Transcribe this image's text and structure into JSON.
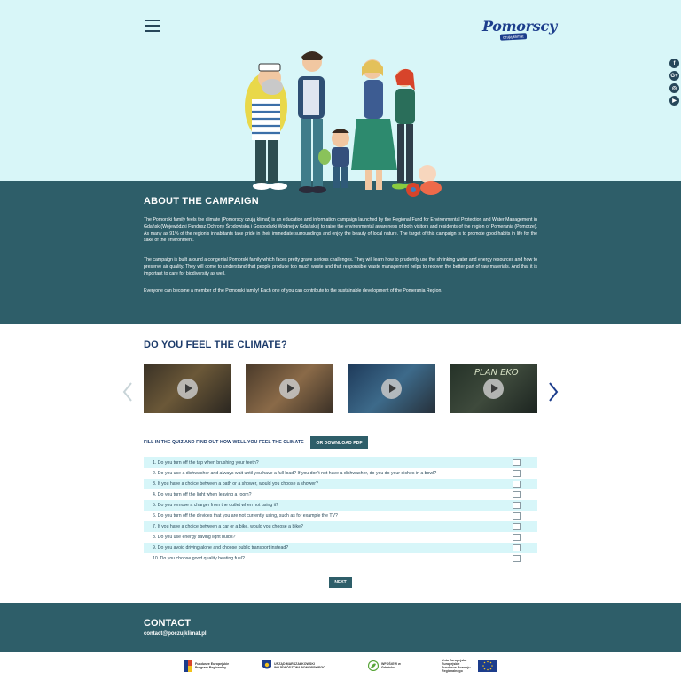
{
  "header": {
    "logo_text": "Pomorscy",
    "logo_subtext": "czują klimat"
  },
  "social": [
    {
      "label": "f",
      "icon": "facebook-icon"
    },
    {
      "label": "G+",
      "icon": "google-plus-icon"
    },
    {
      "label": "◎",
      "icon": "instagram-icon"
    },
    {
      "label": "▶",
      "icon": "youtube-icon"
    }
  ],
  "about": {
    "title": "ABOUT THE CAMPAIGN",
    "p1": "The Pomorski family feels the climate (Pomorscy czują klimat) is an education and information campaign launched by the Regional Fund for Environmental Protection and Water Management in Gdańsk (Wojewódzki Fundusz Ochrony Środowiska i Gospodarki Wodnej w Gdańsku) to raise the environmental awareness of both visitors and residents of the region of Pomerania (Pomorze). As many as 91% of the region's inhabitants take pride in their immediate surroundings and enjoy the beauty of local nature. The target of this campaign is to promote good habits in life for the sake of the environment.",
    "p2": "The campaign is built around a congenial Pomorski family which faces pretty grave serious challenges. They will learn how to prudently use the shrinking water and energy resources and how to preserve air quality. They will come to understand that people produce too much waste and that responsible waste management helps to recover the better part of raw materials. And that it is important to care for biodiversity as well.",
    "p3": "Everyone can become a member of the Pomorski family! Each one of you can contribute to the sustainable development of the Pomerania Region."
  },
  "climate": {
    "title": "DO YOU FEEL THE CLIMATE?",
    "thumb4_text": "PLAN EKO"
  },
  "quiz": {
    "intro": "FILL IN THE QUIZ AND FIND OUT HOW WELL YOU FEEL THE CLIMATE",
    "pdf_label": "OR DOWNLOAD PDF",
    "questions": [
      "1. Do you turn off the tap when brushing your teeth?",
      "2. Do you use a dishwasher and always wait until you have a full load? If you don't not have a dishwasher, do you do your dishes in a bowl?",
      "3. If you have a choice between a bath or a shower, would you choose a shower?",
      "4. Do you turn off the light when leaving a room?",
      "5. Do you remove a charger from the outlet when not using it?",
      "6. Do you turn off the devices that you are not currently using, such as for example the TV?",
      "7. If you have a choice between a car or a bike, would you choose a bike?",
      "8. Do you use energy saving light bulbs?",
      "9. Do you avoid driving alone and choose public transport instead?",
      "10. Do you choose good quality heating fuel?"
    ],
    "next_label": "NEXT"
  },
  "contact": {
    "title": "CONTACT",
    "email": "contact@poczujklimat.pl"
  },
  "partners": {
    "p1": "Fundusze Europejskie Program Regionalny",
    "p2": "URZĄD MARSZAŁKOWSKI WOJEWÓDZTWA POMORSKIEGO",
    "p3": "WFOŚiGW w Gdańsku",
    "p4": "Unia Europejska Europejskie Fundusze Rozwoju Regionalnego"
  },
  "colors": {
    "hero_bg": "#d8f6f8",
    "teal_dark": "#2e5e69",
    "title_navy": "#1b3a6a",
    "row_alt": "#d7f6f9"
  }
}
